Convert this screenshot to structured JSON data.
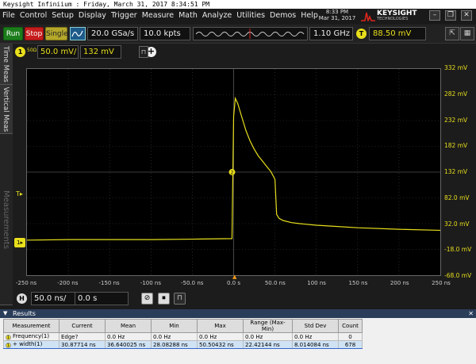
{
  "window": {
    "title": "Keysight Infiniium : Friday, March 31, 2017 8:34:51 PM"
  },
  "menu": [
    "File",
    "Control",
    "Setup",
    "Display",
    "Trigger",
    "Measure",
    "Math",
    "Analyze",
    "Utilities",
    "Demos",
    "Help"
  ],
  "clock": {
    "time": "8:33 PM",
    "date": "Mar 31, 2017"
  },
  "brand": {
    "name": "KEYSIGHT",
    "sub": "TECHNOLOGIES",
    "color": "#d9251c"
  },
  "toolbar": {
    "run": "Run",
    "stop": "Stop",
    "single": "Single",
    "sample_rate": "20.0 GSa/s",
    "memory_depth": "10.0 kpts",
    "bandwidth": "1.10 GHz",
    "trigger_marker": "T",
    "trigger_level": "88.50 mV"
  },
  "side_tabs": {
    "time": "Time Meas",
    "vertical": "Vertical Meas",
    "measurements": "Measurements"
  },
  "channel": {
    "number": "1",
    "impedance": "50Ω",
    "scale": "50.0 mV/",
    "offset": "132 mV",
    "color": "#e8df1c"
  },
  "y_axis": [
    "332 mV",
    "282 mV",
    "232 mV",
    "182 mV",
    "132 mV",
    "82.0 mV",
    "32.0 mV",
    "-18.0 mV",
    "-68.0 mV"
  ],
  "x_axis": [
    "-250 ns",
    "-200 ns",
    "-150 ns",
    "-100 ns",
    "-50.0 ns",
    "0.0 s",
    "50.0 ns",
    "100 ns",
    "150 ns",
    "200 ns",
    "250 ns"
  ],
  "horizontal": {
    "label": "H",
    "scale": "50.0 ns/",
    "position": "0.0 s"
  },
  "results": {
    "title": "Results",
    "columns": [
      "Measurement",
      "Current",
      "Mean",
      "Min",
      "Max",
      "Range (Max-Min)",
      "Std Dev",
      "Count"
    ],
    "rows": [
      [
        "Frequency(1)",
        "Edge?",
        "0.0 Hz",
        "0.0 Hz",
        "0.0 Hz",
        "0.0 Hz",
        "0.0 Hz",
        "0"
      ],
      [
        "+ width(1)",
        "30.87714 ns",
        "36.640025 ns",
        "28.08288 ns",
        "50.50432 ns",
        "22.42144 ns",
        "8.014084 ns",
        "678"
      ]
    ]
  },
  "chart_data": {
    "type": "line",
    "x_unit": "ns",
    "y_unit": "mV",
    "xlim": [
      -250,
      250
    ],
    "ylim": [
      -68,
      332
    ],
    "series": [
      {
        "x": [
          -250,
          -200,
          -150,
          -100,
          -50,
          -2,
          0,
          2,
          5,
          10,
          15,
          20,
          25,
          30,
          35,
          40,
          45,
          50,
          52,
          55,
          60,
          70,
          80,
          100,
          120,
          150,
          200,
          250
        ],
        "y": [
          0,
          1,
          1,
          1,
          2,
          3,
          240,
          275,
          265,
          238,
          212,
          192,
          176,
          163,
          153,
          143,
          133,
          118,
          50,
          42,
          38,
          34,
          32,
          29,
          27,
          24,
          21,
          19
        ]
      }
    ]
  }
}
